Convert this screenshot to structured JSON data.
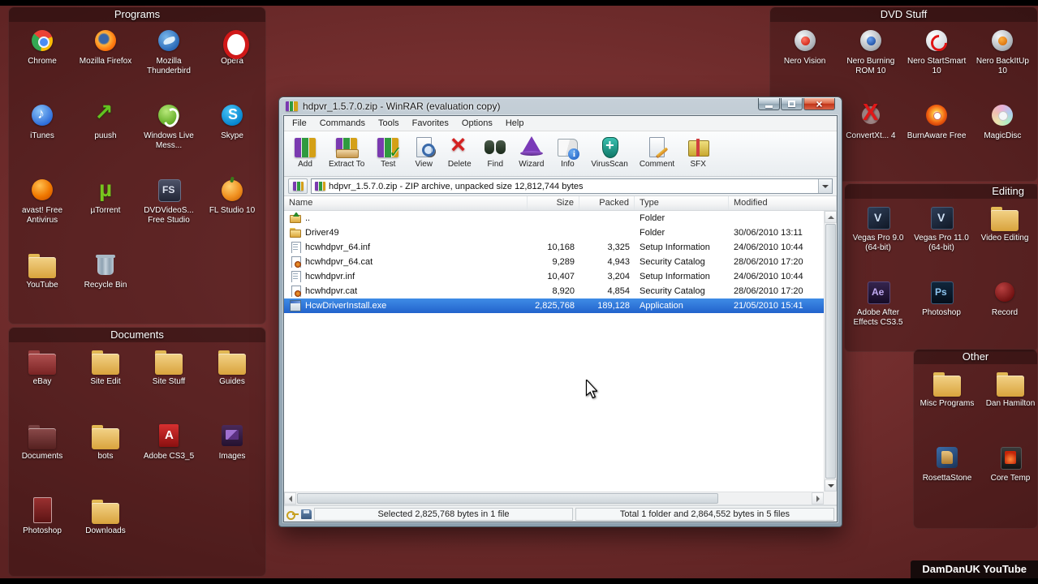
{
  "theme": {
    "desktop_red": "#732e2e",
    "selection_blue": "#3f8ce6"
  },
  "desktop": {
    "fences": [
      {
        "id": "programs",
        "title": "Programs",
        "icons": [
          {
            "label": "Chrome",
            "icon": "chrome"
          },
          {
            "label": "Mozilla Firefox",
            "icon": "firefox"
          },
          {
            "label": "Mozilla Thunderbird",
            "icon": "thunderbird"
          },
          {
            "label": "Opera",
            "icon": "opera"
          },
          {
            "label": "iTunes",
            "icon": "itunes"
          },
          {
            "label": "puush",
            "icon": "puush"
          },
          {
            "label": "Windows Live Mess...",
            "icon": "wlm"
          },
          {
            "label": "Skype",
            "icon": "skype"
          },
          {
            "label": "avast! Free Antivirus",
            "icon": "avast"
          },
          {
            "label": "µTorrent",
            "icon": "utorrent"
          },
          {
            "label": "DVDVideoS... Free Studio",
            "icon": "freestudio"
          },
          {
            "label": "FL Studio 10",
            "icon": "flstudio"
          },
          {
            "label": "YouTube",
            "icon": "folder"
          },
          {
            "label": "Recycle Bin",
            "icon": "recycle"
          }
        ]
      },
      {
        "id": "documents",
        "title": "Documents",
        "icons": [
          {
            "label": "eBay",
            "icon": "folder-red"
          },
          {
            "label": "Site Edit",
            "icon": "folder"
          },
          {
            "label": "Site Stuff",
            "icon": "folder"
          },
          {
            "label": "Guides",
            "icon": "folder"
          },
          {
            "label": "Documents",
            "icon": "folder-dark"
          },
          {
            "label": "bots",
            "icon": "folder"
          },
          {
            "label": "Adobe CS3_5",
            "icon": "adobe"
          },
          {
            "label": "Images",
            "icon": "images"
          },
          {
            "label": "Photoshop",
            "icon": "psdoc"
          },
          {
            "label": "Downloads",
            "icon": "folder"
          }
        ]
      },
      {
        "id": "dvd-stuff",
        "title": "DVD Stuff",
        "icons": [
          {
            "label": "Nero Vision",
            "icon": "nero-vision"
          },
          {
            "label": "Nero Burning ROM 10",
            "icon": "nero-burn"
          },
          {
            "label": "Nero StartSmart 10",
            "icon": "nero-start"
          },
          {
            "label": "Nero BackItUp 10",
            "icon": "nero-backitup"
          },
          {
            "label": "ConvertXt... 4",
            "icon": "convertx"
          },
          {
            "label": "BurnAware Free",
            "icon": "burnaware"
          },
          {
            "label": "MagicDisc",
            "icon": "magicdisc"
          }
        ]
      },
      {
        "id": "editing",
        "title": "Editing",
        "icons": [
          {
            "label": "Vegas Pro 9.0 (64-bit)",
            "icon": "vegas"
          },
          {
            "label": "Vegas Pro 11.0 (64-bit)",
            "icon": "vegas"
          },
          {
            "label": "Video Editing",
            "icon": "folder"
          },
          {
            "label": "Adobe After Effects CS3.5",
            "icon": "ae"
          },
          {
            "label": "Photoshop",
            "icon": "ps"
          },
          {
            "label": "Record",
            "icon": "record"
          }
        ]
      },
      {
        "id": "other",
        "title": "Other",
        "icons": [
          {
            "label": "Misc Programs",
            "icon": "folder"
          },
          {
            "label": "Dan Hamilton",
            "icon": "folder"
          },
          {
            "label": "RosettaStone",
            "icon": "rosetta"
          },
          {
            "label": "Core Temp",
            "icon": "coretemp"
          }
        ]
      }
    ],
    "watermark": "DamDanUK YouTube"
  },
  "window": {
    "title": "hdpvr_1.5.7.0.zip - WinRAR (evaluation copy)",
    "menu": [
      "File",
      "Commands",
      "Tools",
      "Favorites",
      "Options",
      "Help"
    ],
    "toolbar": [
      {
        "label": "Add",
        "icon": "add"
      },
      {
        "label": "Extract To",
        "icon": "extract"
      },
      {
        "label": "Test",
        "icon": "test"
      },
      {
        "label": "View",
        "icon": "view"
      },
      {
        "label": "Delete",
        "icon": "delete"
      },
      {
        "label": "Find",
        "icon": "find"
      },
      {
        "label": "Wizard",
        "icon": "wizard"
      },
      {
        "label": "Info",
        "icon": "info"
      },
      {
        "label": "VirusScan",
        "icon": "virusscan"
      },
      {
        "label": "Comment",
        "icon": "comment"
      },
      {
        "label": "SFX",
        "icon": "sfx"
      }
    ],
    "address": "hdpvr_1.5.7.0.zip - ZIP archive, unpacked size 12,812,744 bytes",
    "list": {
      "columns": [
        {
          "label": "Name",
          "align": "left"
        },
        {
          "label": "Size",
          "align": "right"
        },
        {
          "label": "Packed",
          "align": "right"
        },
        {
          "label": "Type",
          "align": "left"
        },
        {
          "label": "Modified",
          "align": "left"
        }
      ],
      "rows": [
        {
          "name": "..",
          "icon": "folder-up",
          "size": "",
          "packed": "",
          "type": "Folder",
          "modified": "",
          "selected": false
        },
        {
          "name": "Driver49",
          "icon": "folder",
          "size": "",
          "packed": "",
          "type": "Folder",
          "modified": "30/06/2010 13:11",
          "selected": false
        },
        {
          "name": "hcwhdpvr_64.inf",
          "icon": "inf",
          "size": "10,168",
          "packed": "3,325",
          "type": "Setup Information",
          "modified": "24/06/2010 10:44",
          "selected": false
        },
        {
          "name": "hcwhdpvr_64.cat",
          "icon": "cat",
          "size": "9,289",
          "packed": "4,943",
          "type": "Security Catalog",
          "modified": "28/06/2010 17:20",
          "selected": false
        },
        {
          "name": "hcwhdpvr.inf",
          "icon": "inf",
          "size": "10,407",
          "packed": "3,204",
          "type": "Setup Information",
          "modified": "24/06/2010 10:44",
          "selected": false
        },
        {
          "name": "hcwhdpvr.cat",
          "icon": "cat",
          "size": "8,920",
          "packed": "4,854",
          "type": "Security Catalog",
          "modified": "28/06/2010 17:20",
          "selected": false
        },
        {
          "name": "HcwDriverInstall.exe",
          "icon": "exe",
          "size": "2,825,768",
          "packed": "189,128",
          "type": "Application",
          "modified": "21/05/2010 15:41",
          "selected": true
        }
      ]
    },
    "status": {
      "left": "Selected 2,825,768 bytes in 1 file",
      "right": "Total 1 folder and 2,864,552 bytes in 5 files"
    }
  }
}
